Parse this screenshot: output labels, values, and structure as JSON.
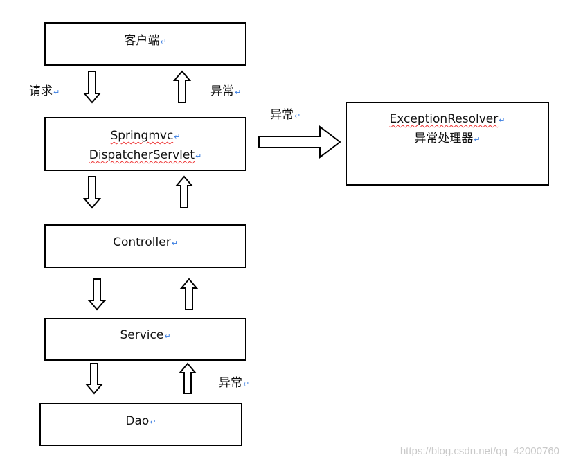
{
  "nodes": {
    "client": "客户端",
    "springmvc": "Springmvc",
    "dispatcher": "DispatcherServlet",
    "controller": "Controller",
    "service": "Service",
    "dao": "Dao",
    "resolver": "ExceptionResolver",
    "resolver_cn": "异常处理器"
  },
  "labels": {
    "request": "请求",
    "exception_top": "异常",
    "exception_right": "异常",
    "exception_bottom": "异常"
  },
  "return_mark": "↵",
  "watermark": "https://blog.csdn.net/qq_42000760"
}
